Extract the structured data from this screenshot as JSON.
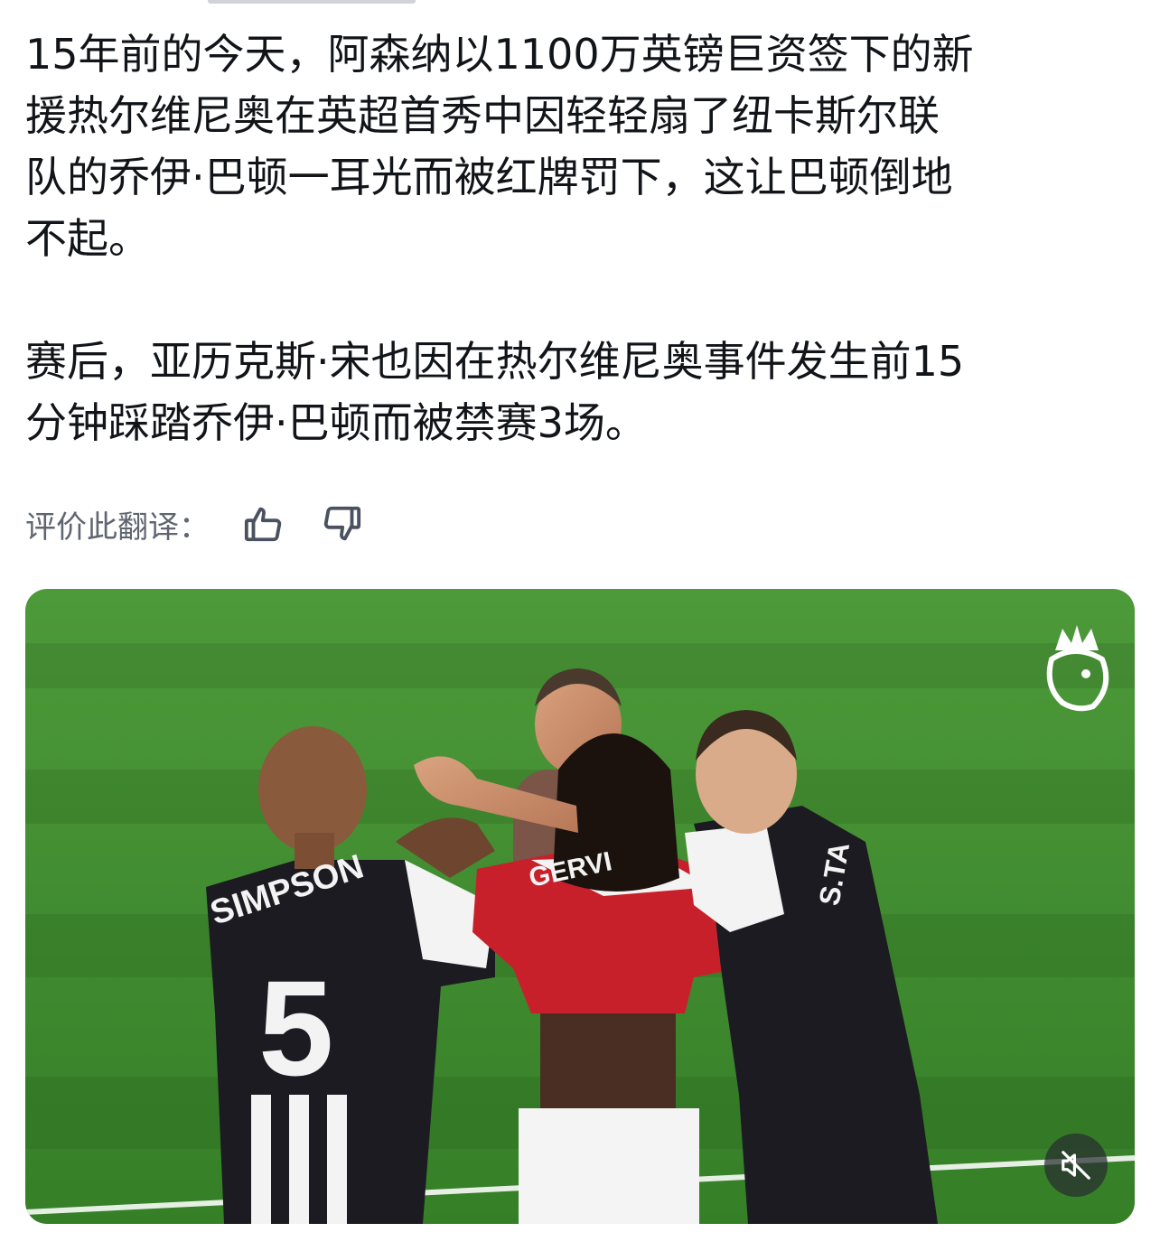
{
  "post": {
    "paragraphs": [
      "15年前的今天，阿森纳以1100万英镑巨资签下的新\n援热尔维尼奥在英超首秀中因轻轻扇了纽卡斯尔联\n队的乔伊·巴顿一耳光而被红牌罚下，这让巴顿倒地\n不起。",
      "赛后，亚历克斯·宋也因在热尔维尼奥事件发生前15\n分钟踩踏乔伊·巴顿而被禁赛3场。"
    ]
  },
  "translation_feedback": {
    "label": "评价此翻译：",
    "like_icon": "thumbs-up-icon",
    "dislike_icon": "thumbs-down-icon"
  },
  "video": {
    "logo_icon": "premier-league-lion-icon",
    "mute_icon": "speaker-muted-icon",
    "jersey_texts": {
      "simpson_name": "SIMPSON",
      "simpson_number": "5",
      "gervinho_name": "GERVI",
      "taylor_name": "S.TA"
    },
    "colors": {
      "pitch": "#3f8f2f",
      "arsenal_red": "#c8202b",
      "newcastle_black": "#1c1b22"
    }
  }
}
